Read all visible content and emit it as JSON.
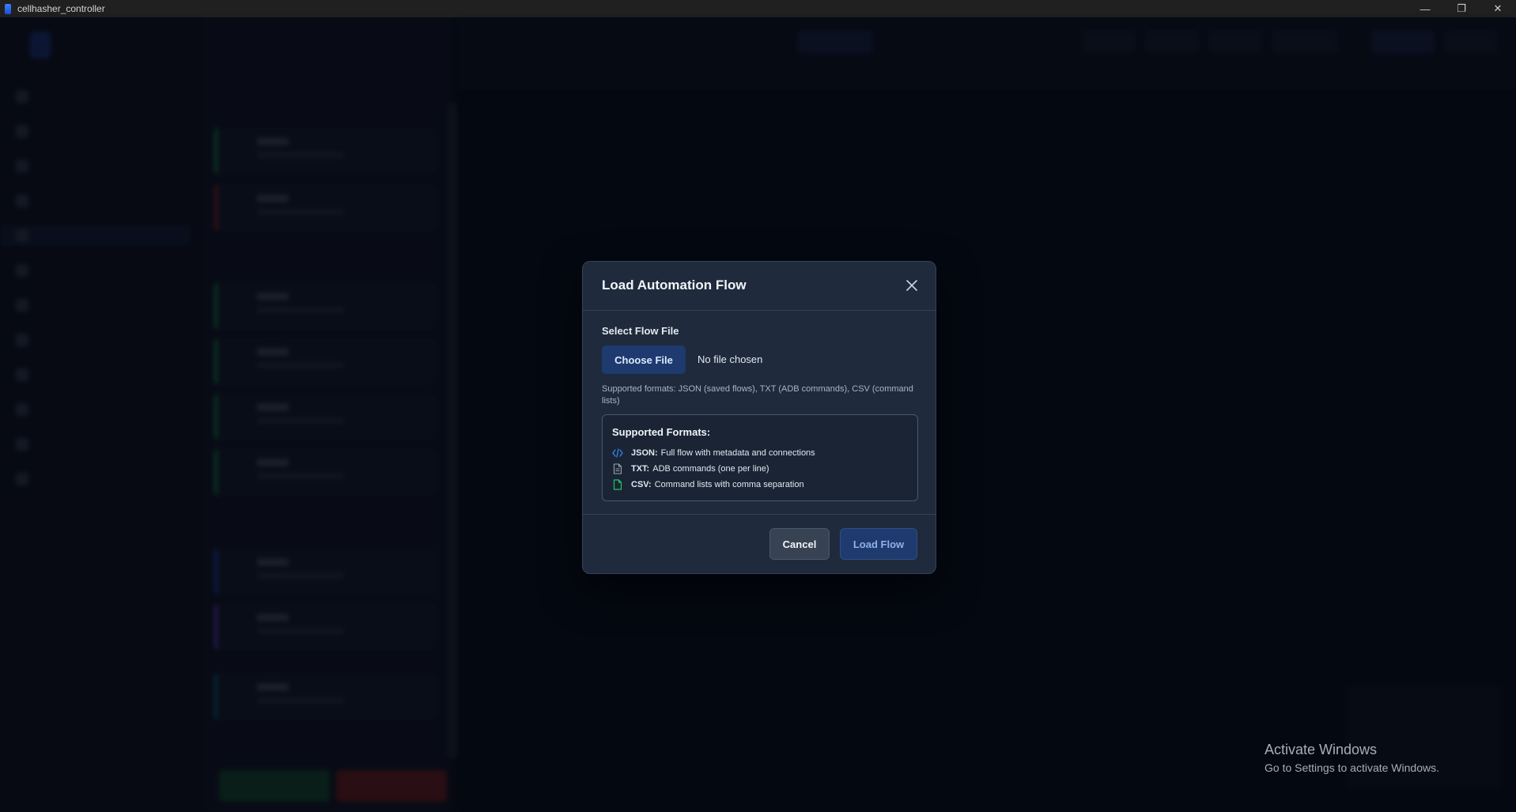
{
  "window": {
    "title": "cellhasher_controller",
    "controls": [
      "—",
      "❐",
      "✕"
    ]
  },
  "modal": {
    "title": "Load Automation Flow",
    "file_label": "Select Flow File",
    "choose_button": "Choose File",
    "file_status": "No file chosen",
    "help_text": "Supported formats: JSON (saved flows), TXT (ADB commands), CSV (command lists)",
    "formats_title": "Supported Formats:",
    "formats": [
      {
        "name": "JSON:",
        "desc": "Full flow with metadata and connections",
        "icon": "code-icon",
        "color": "#3b82f6"
      },
      {
        "name": "TXT:",
        "desc": "ADB commands (one per line)",
        "icon": "document-icon",
        "color": "#9ca3af"
      },
      {
        "name": "CSV:",
        "desc": "Command lists with comma separation",
        "icon": "file-icon",
        "color": "#22c55e"
      }
    ],
    "cancel_button": "Cancel",
    "load_button": "Load Flow"
  },
  "watermark": {
    "line1": "Activate Windows",
    "line2": "Go to Settings to activate Windows."
  }
}
